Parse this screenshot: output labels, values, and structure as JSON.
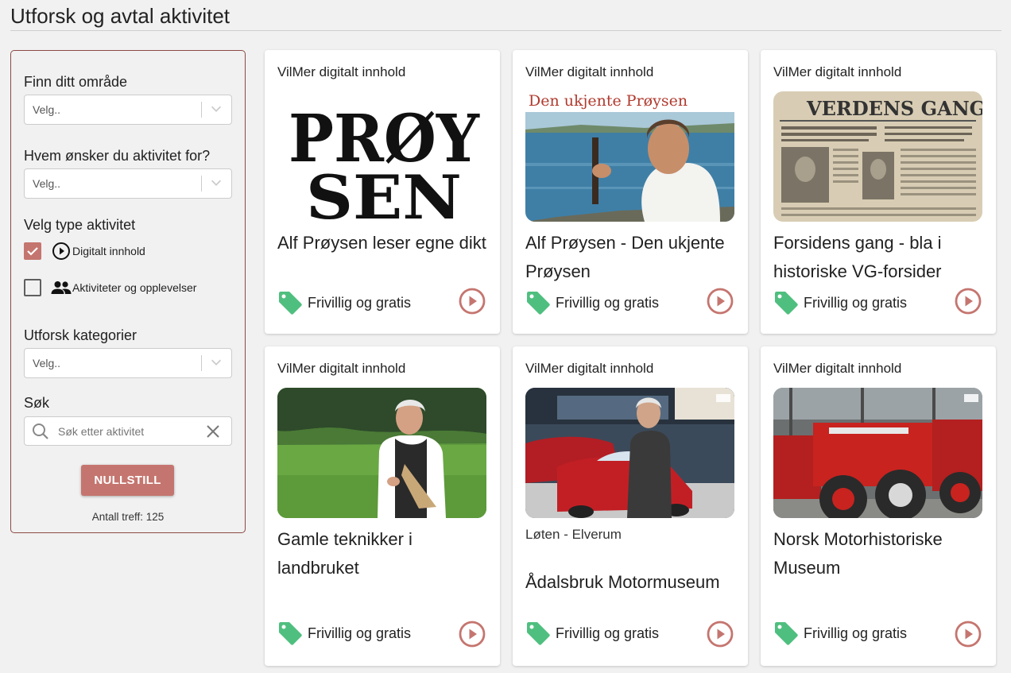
{
  "page": {
    "title": "Utforsk og avtal aktivitet"
  },
  "filters": {
    "area": {
      "label": "Finn ditt område",
      "placeholder": "Velg.."
    },
    "audience": {
      "label": "Hvem ønsker du aktivitet for?",
      "placeholder": "Velg.."
    },
    "type": {
      "label": "Velg type aktivitet",
      "options": [
        {
          "label": "Digitalt innhold",
          "checked": true,
          "icon": "play-circle-icon"
        },
        {
          "label": "Aktiviteter og opplevelser",
          "checked": false,
          "icon": "people-icon"
        }
      ]
    },
    "category": {
      "label": "Utforsk kategorier",
      "placeholder": "Velg.."
    },
    "search": {
      "label": "Søk",
      "placeholder": "Søk etter aktivitet"
    },
    "reset_label": "NULLSTILL",
    "count_text": "Antall treff: 125"
  },
  "colors": {
    "accent": "#c5756f",
    "tag": "#4fbf7f",
    "panel_border": "#8b4a44"
  },
  "cards": [
    {
      "category": "VilMer digitalt innhold",
      "title": "Alf Prøysen leser egne dikt",
      "location": "",
      "price": "Frivillig og gratis",
      "image": "proysen-text-logo"
    },
    {
      "category": "VilMer digitalt innhold",
      "title": "Alf Prøysen - Den ukjente Prøysen",
      "location": "",
      "price": "Frivillig og gratis",
      "image": "man-with-guitar-at-lake",
      "image_caption": "Den ukjente Prøysen"
    },
    {
      "category": "VilMer digitalt innhold",
      "title": "Forsidens gang - bla i historiske VG-forsider",
      "location": "",
      "price": "Frivillig og gratis",
      "image": "old-newspaper-front-page",
      "image_caption": "VERDENS GANG"
    },
    {
      "category": "VilMer digitalt innhold",
      "title": "Gamle teknikker i landbruket",
      "location": "",
      "price": "Frivillig og gratis",
      "image": "man-in-field"
    },
    {
      "category": "VilMer digitalt innhold",
      "title": "Ådalsbruk Motormuseum",
      "location": "Løten - Elverum",
      "price": "Frivillig og gratis",
      "image": "man-with-red-cars"
    },
    {
      "category": "VilMer digitalt innhold",
      "title": "Norsk Motorhistoriske Museum",
      "location": "",
      "price": "Frivillig og gratis",
      "image": "red-tractors"
    }
  ]
}
